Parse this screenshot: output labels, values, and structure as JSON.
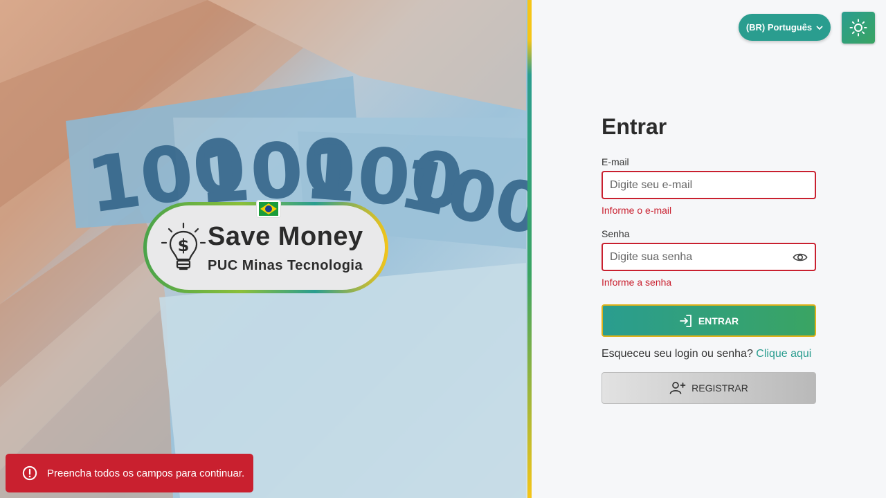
{
  "hero": {
    "brand_title": "Save Money",
    "brand_subtitle": "PUC Minas Tecnologia",
    "banknote_value": "100"
  },
  "header": {
    "language_label": "(BR) Português",
    "theme_icon": "sun-icon"
  },
  "login": {
    "title": "Entrar",
    "email_label": "E-mail",
    "email_placeholder": "Digite seu e-mail",
    "email_value": "",
    "email_error": "Informe o e-mail",
    "password_label": "Senha",
    "password_placeholder": "Digite sua senha",
    "password_value": "",
    "password_error": "Informe a senha",
    "submit_label": "ENTRAR",
    "forgot_text": "Esqueceu seu login ou senha?",
    "forgot_link": "Clique aqui",
    "register_label": "REGISTRAR"
  },
  "toast": {
    "message": "Preencha todos os campos para continuar.",
    "icon": "alert-circle-icon"
  },
  "colors": {
    "accent": "#2a9d8f",
    "accent2": "#3aa463",
    "error": "#c9202f",
    "gold": "#f5c518"
  }
}
